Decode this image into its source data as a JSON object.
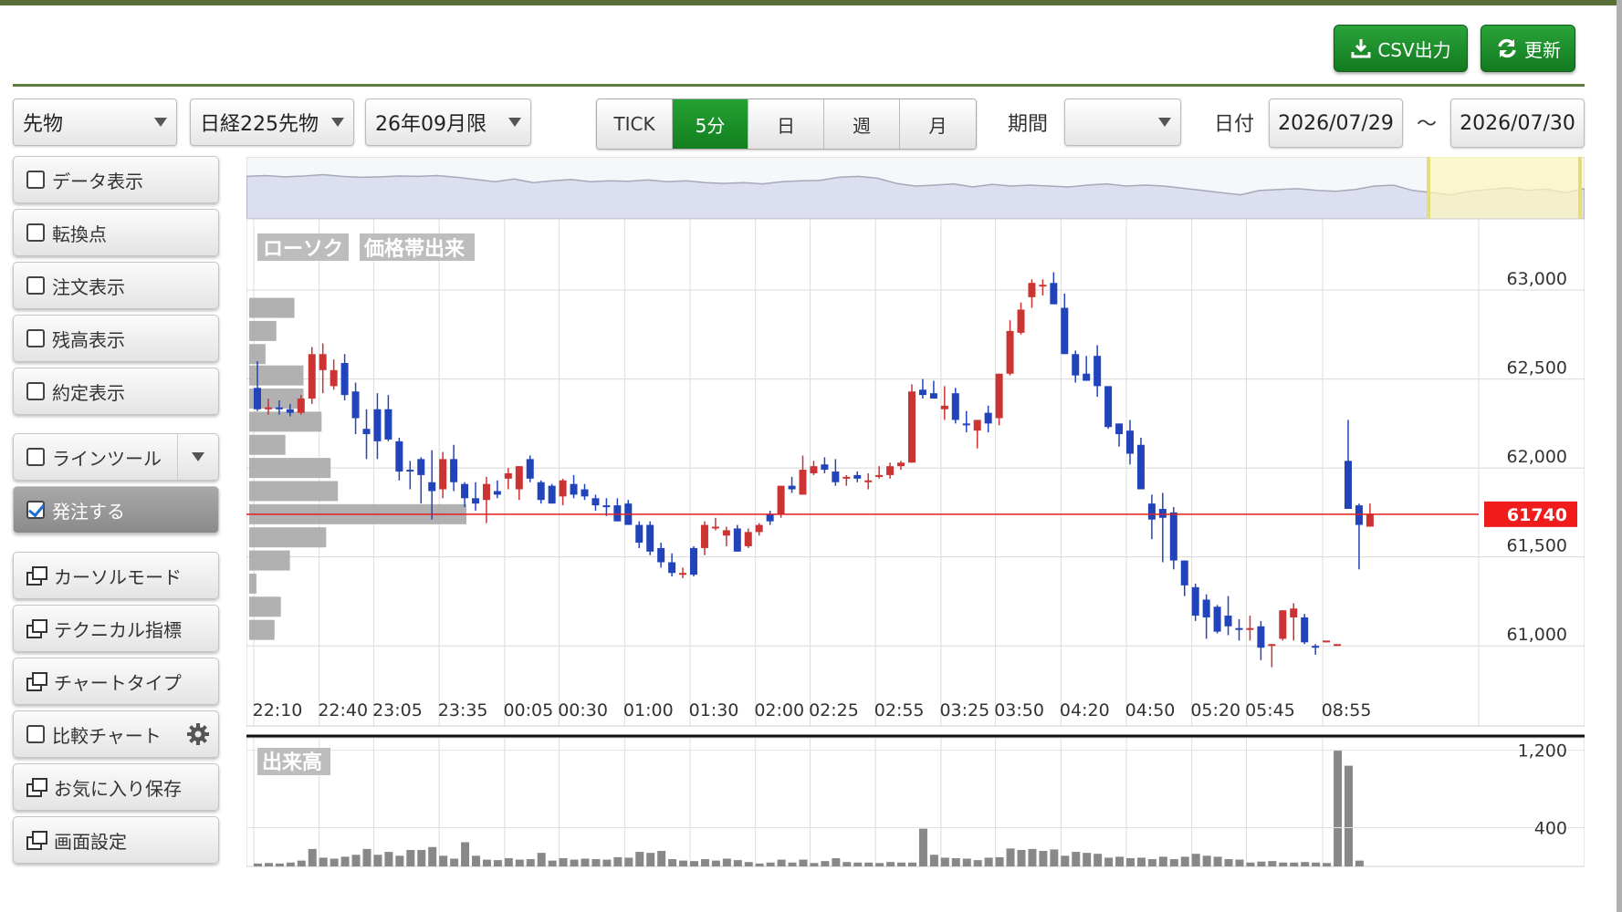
{
  "toolbar": {
    "csv_label": "CSV出力",
    "refresh_label": "更新"
  },
  "selectors": {
    "market": "先物",
    "product": "日経225先物",
    "contract": "26年09月限"
  },
  "timeframe": {
    "tabs": [
      "TICK",
      "5分",
      "日",
      "週",
      "月"
    ],
    "active": "5分"
  },
  "period": {
    "label": "期間",
    "value": ""
  },
  "date": {
    "label": "日付",
    "from": "2026/07/29",
    "separator": "～",
    "to": "2026/07/30"
  },
  "sidebar": {
    "items": [
      {
        "label": "データ表示",
        "kind": "checkbox",
        "checked": false
      },
      {
        "label": "転換点",
        "kind": "checkbox",
        "checked": false
      },
      {
        "label": "注文表示",
        "kind": "checkbox",
        "checked": false
      },
      {
        "label": "残高表示",
        "kind": "checkbox",
        "checked": false
      },
      {
        "label": "約定表示",
        "kind": "checkbox",
        "checked": false
      },
      {
        "label": "ラインツール",
        "kind": "checkbox-dropdown",
        "checked": false
      },
      {
        "label": "発注する",
        "kind": "checkbox",
        "checked": true
      },
      {
        "label": "カーソルモード",
        "kind": "window"
      },
      {
        "label": "テクニカル指標",
        "kind": "window"
      },
      {
        "label": "チャートタイプ",
        "kind": "window"
      },
      {
        "label": "比較チャート",
        "kind": "checkbox-gear",
        "checked": false
      },
      {
        "label": "お気に入り保存",
        "kind": "window"
      },
      {
        "label": "画面設定",
        "kind": "window"
      }
    ]
  },
  "colors": {
    "up": "#cc3333",
    "down": "#2244bb",
    "price_line": "#e02020",
    "accent_green": "#1b8f2a",
    "volume": "#888888",
    "profile": "#a8a8a8"
  },
  "chart_data": {
    "type": "candlestick",
    "tags": {
      "main": "ローソク",
      "profile": "価格帯出来",
      "volume": "出来高"
    },
    "current_price": 61740,
    "ylim": [
      60550,
      63400
    ],
    "y_ticks": [
      61000,
      61500,
      62000,
      62500,
      63000
    ],
    "y_tick_labels": [
      "61,000",
      "61,500",
      "62,000",
      "62,500",
      "63,000"
    ],
    "x_tick_labels": [
      "22:10",
      "22:40",
      "23:05",
      "23:35",
      "00:05",
      "00:30",
      "01:00",
      "01:30",
      "02:00",
      "02:25",
      "02:55",
      "03:25",
      "03:50",
      "04:20",
      "04:50",
      "05:20",
      "05:45",
      "08:55"
    ],
    "candles": [
      [
        62450,
        62600,
        62320,
        62330
      ],
      [
        62330,
        62390,
        62300,
        62340
      ],
      [
        62340,
        62380,
        62300,
        62330
      ],
      [
        62330,
        62360,
        62290,
        62310
      ],
      [
        62310,
        62410,
        62300,
        62390
      ],
      [
        62390,
        62680,
        62360,
        62640
      ],
      [
        62550,
        62700,
        62420,
        62640
      ],
      [
        62460,
        62610,
        62440,
        62550
      ],
      [
        62590,
        62640,
        62380,
        62410
      ],
      [
        62430,
        62480,
        62190,
        62280
      ],
      [
        62220,
        62330,
        62050,
        62190
      ],
      [
        62330,
        62420,
        62050,
        62150
      ],
      [
        62330,
        62410,
        62150,
        62160
      ],
      [
        62150,
        62170,
        61930,
        61980
      ],
      [
        61990,
        62040,
        61880,
        61980
      ],
      [
        62050,
        62060,
        61800,
        61960
      ],
      [
        61920,
        62100,
        61710,
        61870
      ],
      [
        61880,
        62090,
        61830,
        62050
      ],
      [
        62050,
        62130,
        61870,
        61920
      ],
      [
        61910,
        61920,
        61780,
        61830
      ],
      [
        61830,
        61920,
        61760,
        61800
      ],
      [
        61820,
        61950,
        61690,
        61910
      ],
      [
        61870,
        61930,
        61830,
        61850
      ],
      [
        61940,
        62000,
        61880,
        61970
      ],
      [
        61880,
        61990,
        61820,
        62010
      ],
      [
        62050,
        62070,
        61920,
        61940
      ],
      [
        61920,
        61930,
        61800,
        61820
      ],
      [
        61900,
        61910,
        61830,
        61800
      ],
      [
        61840,
        61940,
        61790,
        61930
      ],
      [
        61910,
        61960,
        61830,
        61850
      ],
      [
        61880,
        61910,
        61820,
        61840
      ],
      [
        61830,
        61850,
        61760,
        61790
      ],
      [
        61790,
        61830,
        61730,
        61780
      ],
      [
        61790,
        61830,
        61710,
        61700
      ],
      [
        61800,
        61820,
        61730,
        61680
      ],
      [
        61680,
        61700,
        61550,
        61580
      ],
      [
        61680,
        61700,
        61510,
        61530
      ],
      [
        61550,
        61580,
        61440,
        61470
      ],
      [
        61470,
        61520,
        61390,
        61410
      ],
      [
        61410,
        61440,
        61380,
        61410
      ],
      [
        61550,
        61560,
        61390,
        61400
      ],
      [
        61550,
        61700,
        61510,
        61680
      ],
      [
        61660,
        61720,
        61650,
        61670
      ],
      [
        61620,
        61670,
        61560,
        61650
      ],
      [
        61660,
        61680,
        61540,
        61530
      ],
      [
        61560,
        61660,
        61550,
        61640
      ],
      [
        61640,
        61690,
        61620,
        61680
      ],
      [
        61740,
        61760,
        61680,
        61700
      ],
      [
        61740,
        61890,
        61720,
        61900
      ],
      [
        61900,
        61950,
        61860,
        61880
      ],
      [
        61850,
        62070,
        61850,
        61990
      ],
      [
        61970,
        62040,
        61960,
        62010
      ],
      [
        62020,
        62060,
        61970,
        61990
      ],
      [
        61980,
        62050,
        61900,
        61920
      ],
      [
        61950,
        61960,
        61900,
        61950
      ],
      [
        61960,
        61980,
        61920,
        61940
      ],
      [
        61920,
        61970,
        61880,
        61930
      ],
      [
        61950,
        62010,
        61940,
        61960
      ],
      [
        61960,
        62030,
        61940,
        62010
      ],
      [
        62010,
        62040,
        61990,
        62030
      ],
      [
        62030,
        62470,
        62030,
        62430
      ],
      [
        62440,
        62500,
        62390,
        62410
      ],
      [
        62420,
        62490,
        62400,
        62390
      ],
      [
        62330,
        62460,
        62270,
        62350
      ],
      [
        62420,
        62450,
        62250,
        62270
      ],
      [
        62250,
        62320,
        62200,
        62240
      ],
      [
        62210,
        62240,
        62110,
        62270
      ],
      [
        62310,
        62350,
        62200,
        62250
      ],
      [
        62280,
        62470,
        62240,
        62530
      ],
      [
        62530,
        62830,
        62520,
        62770
      ],
      [
        62760,
        62930,
        62750,
        62890
      ],
      [
        62960,
        63060,
        62900,
        63040
      ],
      [
        63020,
        63060,
        62970,
        63030
      ],
      [
        63040,
        63100,
        62920,
        62920
      ],
      [
        62900,
        62980,
        62790,
        62640
      ],
      [
        62640,
        62660,
        62480,
        62520
      ],
      [
        62530,
        62630,
        62560,
        62490
      ],
      [
        62630,
        62690,
        62400,
        62460
      ],
      [
        62460,
        62430,
        62220,
        62230
      ],
      [
        62250,
        62230,
        62120,
        62190
      ],
      [
        62210,
        62270,
        62020,
        62080
      ],
      [
        62130,
        62170,
        61880,
        61880
      ],
      [
        61800,
        61850,
        61600,
        61710
      ],
      [
        61770,
        61860,
        61470,
        61720
      ],
      [
        61750,
        61780,
        61430,
        61480
      ],
      [
        61480,
        61470,
        61280,
        61340
      ],
      [
        61330,
        61350,
        61140,
        61170
      ],
      [
        61260,
        61290,
        61040,
        61160
      ],
      [
        61220,
        61230,
        61070,
        61080
      ],
      [
        61170,
        61280,
        61060,
        61110
      ],
      [
        61100,
        61150,
        61030,
        61090
      ],
      [
        61100,
        61170,
        61030,
        61100
      ],
      [
        61110,
        61140,
        60920,
        60990
      ],
      [
        61000,
        61010,
        60880,
        61010
      ],
      [
        61040,
        61130,
        61030,
        61200
      ],
      [
        61160,
        61240,
        61030,
        61210
      ],
      [
        61160,
        61180,
        61010,
        61020
      ],
      [
        61000,
        61010,
        60950,
        60990
      ],
      [
        61030,
        61030,
        61020,
        61030
      ],
      [
        61010,
        61010,
        61000,
        61010
      ],
      [
        62040,
        62270,
        61910,
        61770
      ],
      [
        61790,
        61800,
        61430,
        61680
      ],
      [
        61670,
        61800,
        61720,
        61740
      ]
    ],
    "volume": [
      30,
      35,
      30,
      40,
      60,
      180,
      90,
      80,
      100,
      120,
      180,
      120,
      150,
      110,
      170,
      170,
      200,
      110,
      80,
      250,
      110,
      70,
      65,
      85,
      70,
      75,
      140,
      60,
      85,
      70,
      80,
      75,
      70,
      95,
      90,
      150,
      140,
      160,
      75,
      60,
      55,
      75,
      60,
      80,
      65,
      45,
      30,
      40,
      70,
      40,
      70,
      35,
      55,
      85,
      45,
      40,
      40,
      35,
      45,
      40,
      40,
      390,
      120,
      90,
      85,
      80,
      65,
      90,
      95,
      185,
      170,
      180,
      160,
      175,
      110,
      150,
      140,
      130,
      90,
      100,
      85,
      90,
      75,
      100,
      75,
      100,
      130,
      110,
      100,
      75,
      70,
      40,
      50,
      55,
      40,
      40,
      45,
      40,
      35,
      1200,
      1040,
      60
    ],
    "volume_ylim": [
      0,
      1300
    ],
    "volume_y_ticks": [
      400,
      1200
    ],
    "volume_y_tick_labels": [
      "400",
      "1,200"
    ],
    "price_profile": [
      {
        "price": 62900,
        "vol": 50
      },
      {
        "price": 62770,
        "vol": 30
      },
      {
        "price": 62640,
        "vol": 18
      },
      {
        "price": 62520,
        "vol": 60
      },
      {
        "price": 62390,
        "vol": 60
      },
      {
        "price": 62260,
        "vol": 80
      },
      {
        "price": 62130,
        "vol": 40
      },
      {
        "price": 62000,
        "vol": 90
      },
      {
        "price": 61870,
        "vol": 98
      },
      {
        "price": 61740,
        "vol": 240
      },
      {
        "price": 61610,
        "vol": 85
      },
      {
        "price": 61480,
        "vol": 45
      },
      {
        "price": 61350,
        "vol": 8
      },
      {
        "price": 61220,
        "vol": 35
      },
      {
        "price": 61090,
        "vol": 28
      }
    ],
    "navigator": [
      0.72,
      0.74,
      0.71,
      0.73,
      0.76,
      0.72,
      0.7,
      0.71,
      0.73,
      0.72,
      0.74,
      0.7,
      0.65,
      0.6,
      0.66,
      0.58,
      0.62,
      0.65,
      0.6,
      0.62,
      0.61,
      0.64,
      0.6,
      0.62,
      0.58,
      0.56,
      0.58,
      0.55,
      0.6,
      0.62,
      0.63,
      0.7,
      0.72,
      0.68,
      0.56,
      0.5,
      0.52,
      0.55,
      0.48,
      0.54,
      0.5,
      0.52,
      0.5,
      0.48,
      0.52,
      0.55,
      0.5,
      0.52,
      0.5,
      0.45,
      0.4,
      0.35,
      0.3,
      0.4,
      0.42,
      0.44,
      0.4,
      0.38,
      0.42,
      0.5,
      0.52,
      0.4,
      0.35,
      0.3,
      0.38,
      0.42,
      0.46,
      0.4,
      0.43,
      0.35,
      0.44
    ]
  }
}
